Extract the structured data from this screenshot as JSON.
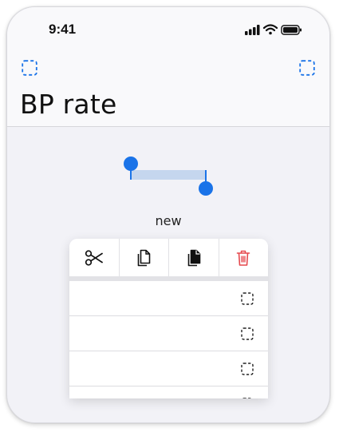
{
  "status_bar": {
    "time": "9:41",
    "icons": [
      "signal-icon",
      "wifi-icon",
      "battery-icon"
    ]
  },
  "nav": {
    "left_icon": "placeholder-icon",
    "right_icon": "placeholder-icon"
  },
  "page": {
    "title": "BP rate"
  },
  "shape": {
    "label": "new"
  },
  "context_menu": {
    "actions": [
      "cut-icon",
      "copy-icon",
      "duplicate-icon",
      "delete-icon"
    ],
    "rows": [
      {
        "icon": "placeholder-icon"
      },
      {
        "icon": "placeholder-icon"
      },
      {
        "icon": "placeholder-icon"
      },
      {
        "icon": "placeholder-icon"
      }
    ]
  },
  "colors": {
    "accent": "#1a73e8",
    "delete": "#e5484d",
    "selection": "#c5d6ee"
  }
}
